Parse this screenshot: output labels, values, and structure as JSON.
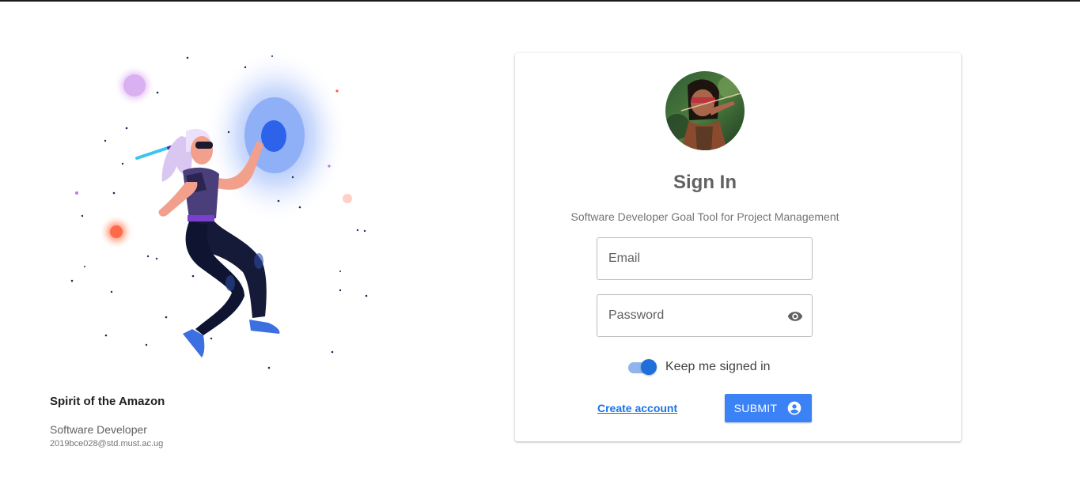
{
  "profile": {
    "name": "Spirit of the Amazon",
    "role": "Software Developer",
    "email": "2019bce028@std.must.ac.ug"
  },
  "signin": {
    "title": "Sign In",
    "subtitle": "Software Developer Goal Tool for Project Management",
    "email_placeholder": "Email",
    "email_value": "",
    "password_placeholder": "Password",
    "password_value": "",
    "keep_signed_in_label": "Keep me signed in",
    "keep_signed_in": true,
    "create_account_label": "Create account",
    "submit_label": "SUBMIT"
  },
  "icons": {
    "password_toggle": "eye-icon",
    "submit": "account-circle-icon"
  },
  "colors": {
    "accent": "#3b82f6",
    "link": "#1a73e8",
    "switch_thumb": "#1e6fd9",
    "switch_track": "#8fb5ec",
    "portal_glow": "#2f6df0"
  }
}
